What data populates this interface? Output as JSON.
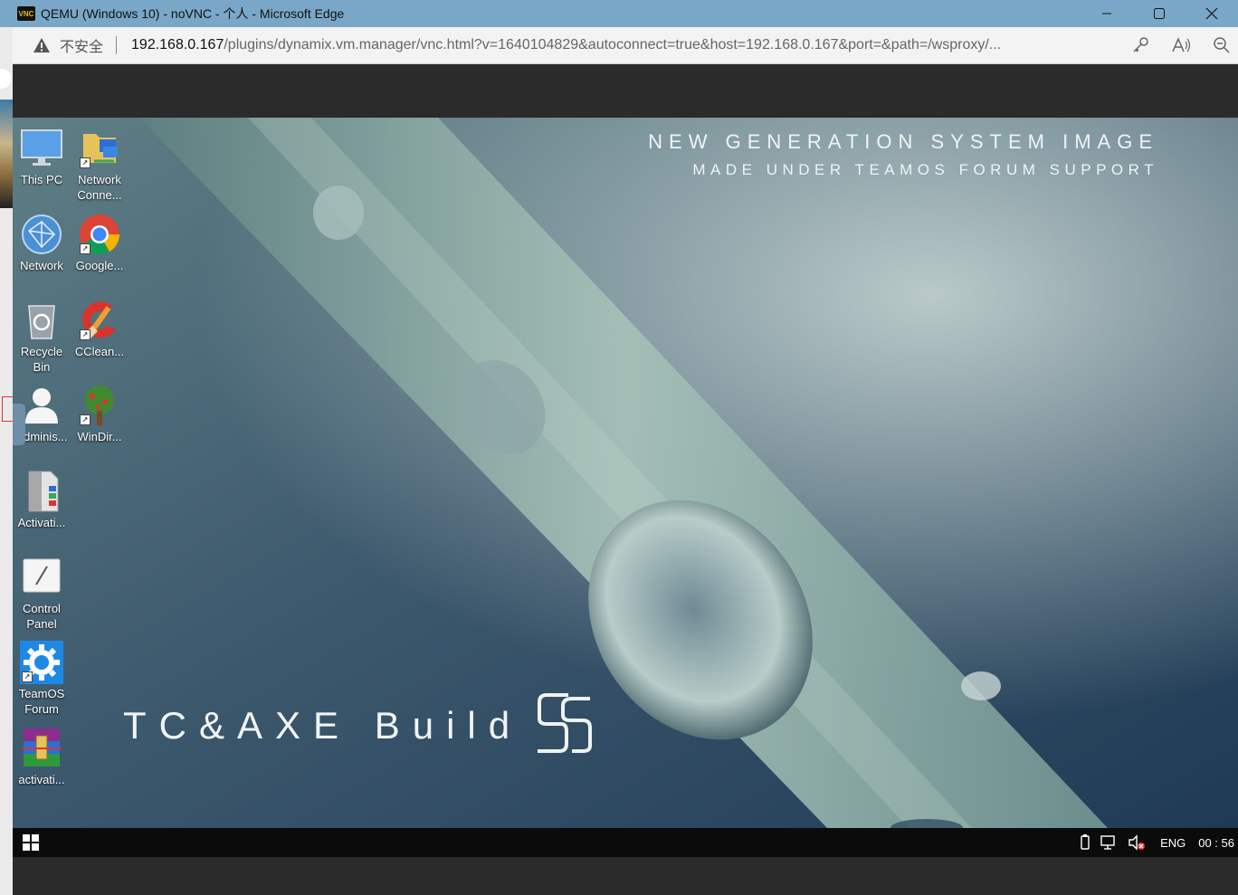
{
  "browser": {
    "window_title": "QEMU (Windows 10) - noVNC - 个人 - Microsoft Edge",
    "app_icon_text": "VNC",
    "security_label": "不安全",
    "url_host": "192.168.0.167",
    "url_rest": "/plugins/dynamix.vm.manager/vnc.html?v=1640104829&autoconnect=true&host=192.168.0.167&port=&path=/wsproxy/..."
  },
  "desktop": {
    "brand_line1": "NEW GENERATION SYSTEM IMAGE",
    "brand_line2": "MADE UNDER TEAMOS FORUM SUPPORT",
    "build_text": "TC&AXE Build",
    "icons": [
      {
        "label": "This PC",
        "icon": "monitor-icon"
      },
      {
        "label": "Network Conne...",
        "icon": "network-connections-icon"
      },
      {
        "label": "Network",
        "icon": "globe-network-icon"
      },
      {
        "label": "Google...",
        "icon": "chrome-icon"
      },
      {
        "label": "Recycle Bin",
        "icon": "recycle-bin-icon"
      },
      {
        "label": "CClean...",
        "icon": "ccleaner-icon"
      },
      {
        "label": "Adminis...",
        "icon": "user-icon"
      },
      {
        "label": "WinDir...",
        "icon": "tree-icon"
      },
      {
        "label": "Activati...",
        "icon": "archive-file-icon"
      },
      {
        "label": "Control Panel",
        "icon": "control-panel-icon"
      },
      {
        "label": "TeamOS Forum",
        "icon": "gear-icon"
      },
      {
        "label": "activati...",
        "icon": "winrar-icon"
      }
    ]
  },
  "taskbar": {
    "language": "ENG",
    "clock": "00 : 56"
  }
}
